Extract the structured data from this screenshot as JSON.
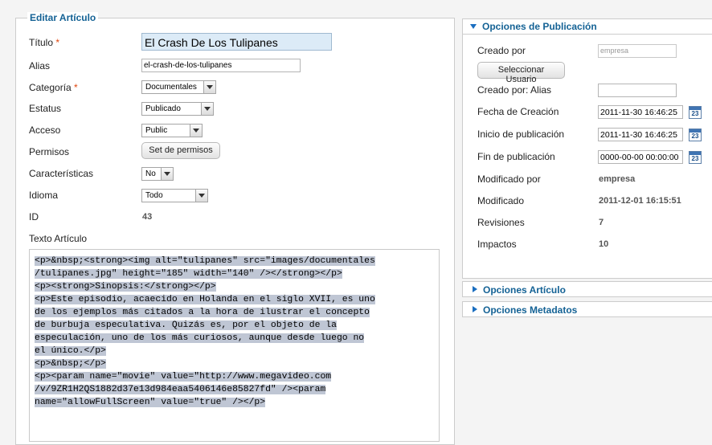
{
  "form": {
    "legend": "Editar Artículo",
    "fields": {
      "titulo": {
        "label": "Título",
        "value": "El Crash De Los Tulipanes"
      },
      "alias": {
        "label": "Alias",
        "value": "el-crash-de-los-tulipanes"
      },
      "categoria": {
        "label": "Categoría",
        "value": "Documentales"
      },
      "estatus": {
        "label": "Estatus",
        "value": "Publicado"
      },
      "acceso": {
        "label": "Acceso",
        "value": "Public"
      },
      "permisos": {
        "label": "Permisos",
        "button": "Set de permisos"
      },
      "caracteristicas": {
        "label": "Características",
        "value": "No"
      },
      "idioma": {
        "label": "Idioma",
        "value": "Todo"
      },
      "id": {
        "label": "ID",
        "value": "43"
      }
    },
    "required_marker": "*",
    "editor": {
      "label": "Texto Artículo",
      "lines": [
        "<p>&nbsp;<strong><img alt=\"tulipanes\" src=\"images/documentales",
        "/tulipanes.jpg\" height=\"185\" width=\"140\" /></strong></p>",
        "<p><strong>Sinopsis:</strong></p>",
        "<p>Este episodio, acaecido en Holanda en el siglo XVII, es uno",
        "de los ejemplos más citados a la hora de ilustrar el concepto",
        "de burbuja especulativa. Quizás es, por el objeto de la",
        "especulación, uno de los más curiosos, aunque desde luego no",
        "el único.</p>",
        "<p>&nbsp;</p>",
        "<p><param name=\"movie\" value=\"http://www.megavideo.com",
        "/v/9ZR1H2QS1882d37e13d984eaa5406146e85827fd\" /><param",
        "name=\"allowFullScreen\" value=\"true\" /></p>"
      ]
    }
  },
  "publicacion": {
    "title": "Opciones de Publicación",
    "creado_por": {
      "label": "Creado por",
      "placeholder": "empresa"
    },
    "seleccionar_usuario": "Seleccionar Usuario",
    "creado_por_alias": {
      "label": "Creado por: Alias",
      "value": ""
    },
    "fecha_creacion": {
      "label": "Fecha de Creación",
      "value": "2011-11-30 16:46:25"
    },
    "inicio_publicacion": {
      "label": "Inicio de publicación",
      "value": "2011-11-30 16:46:25"
    },
    "fin_publicacion": {
      "label": "Fin de publicación",
      "value": "0000-00-00 00:00:00"
    },
    "modificado_por": {
      "label": "Modificado por",
      "value": "empresa"
    },
    "modificado": {
      "label": "Modificado",
      "value": "2011-12-01 16:15:51"
    },
    "revisiones": {
      "label": "Revisiones",
      "value": "7"
    },
    "impactos": {
      "label": "Impactos",
      "value": "10"
    },
    "calendar_icon_text": "23"
  },
  "panels": {
    "opciones_articulo": "Opciones Artículo",
    "opciones_metadatos": "Opciones Metadatos"
  }
}
